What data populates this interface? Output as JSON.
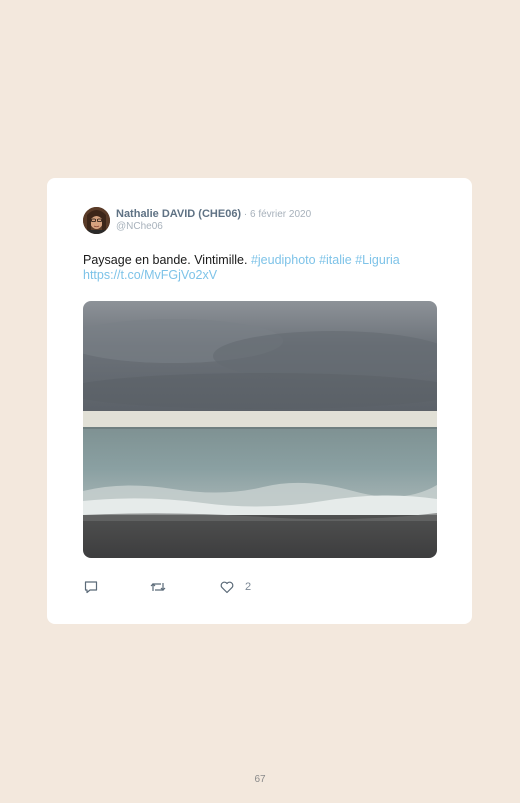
{
  "tweet": {
    "author_name": "Nathalie DAVID (CHE06)",
    "separator": " · ",
    "date": "6 février 2020",
    "handle": "@NChe06",
    "text_plain": "Paysage en bande. Vintimille. ",
    "hashtags": [
      "#jeudiphoto",
      "#italie",
      "#Liguria"
    ],
    "link": "https://t.co/MvFGjVo2xV",
    "like_count": "2"
  },
  "icons": {
    "reply": "reply-icon",
    "retweet": "retweet-icon",
    "like": "heart-icon"
  },
  "colors": {
    "page_background": "#f3e8dd",
    "card_background": "#ffffff",
    "author_name": "#5f7284",
    "meta_text": "#a7b1bb",
    "link_blue": "#7ec3e8"
  },
  "page": {
    "number": "67"
  }
}
